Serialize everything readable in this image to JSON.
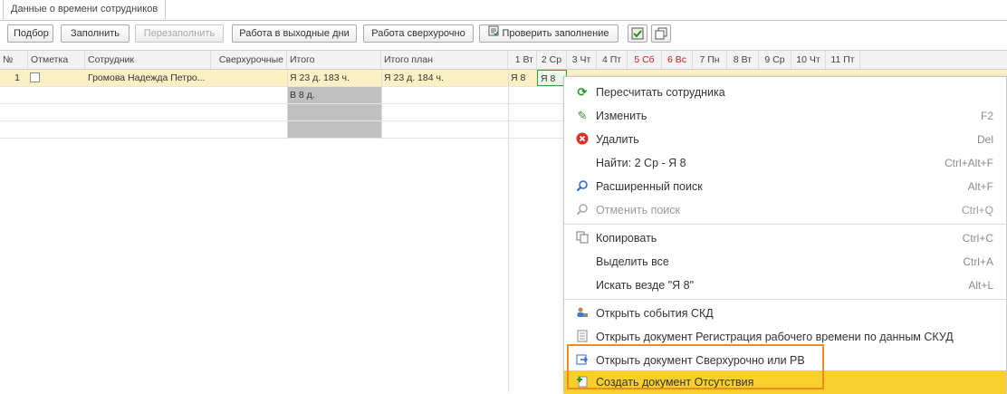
{
  "tab": {
    "label": "Данные о времени сотрудников"
  },
  "toolbar": {
    "podbor": "Подбор",
    "zapolnit": "Заполнить",
    "perezapolnit": "Перезаполнить",
    "rabota_vyh": "Работа в выходные дни",
    "rabota_sverh": "Работа сверхурочно",
    "proverit": "Проверить заполнение"
  },
  "table": {
    "headers": {
      "num": "№",
      "otmetka": "Отметка",
      "sotrudnik": "Сотрудник",
      "sverh": "Сверхурочные",
      "itogo": "Итого",
      "itogo_plan": "Итого план",
      "d1": "1 Вт",
      "d2": "2 Ср",
      "d3": "3 Чт",
      "d4": "4 Пт",
      "d5": "5 Сб",
      "d6": "6 Вс",
      "d7": "7 Пн",
      "d8": "8 Вт",
      "d9": "9 Ср",
      "d10": "10 Чт",
      "d11": "11 Пт"
    },
    "row1": {
      "num": "1",
      "sotrudnik": "Громова Надежда Петро...",
      "itogo": "Я 23 д. 183 ч.",
      "itogo_plan": "Я 23 д. 184 ч.",
      "d1": "Я 8",
      "d2": "Я 8"
    },
    "row2": {
      "itogo": "В 8 д."
    }
  },
  "context_menu": {
    "items": [
      {
        "label": "Пересчитать сотрудника",
        "key": ""
      },
      {
        "label": "Изменить",
        "key": "F2"
      },
      {
        "label": "Удалить",
        "key": "Del"
      },
      {
        "label": "Найти: 2 Ср - Я 8",
        "key": "Ctrl+Alt+F"
      },
      {
        "label": "Расширенный поиск",
        "key": "Alt+F"
      },
      {
        "label": "Отменить поиск",
        "key": "Ctrl+Q"
      },
      {
        "label": "Копировать",
        "key": "Ctrl+C"
      },
      {
        "label": "Выделить все",
        "key": "Ctrl+A"
      },
      {
        "label": "Искать везде \"Я 8\"",
        "key": "Alt+L"
      },
      {
        "label": "Открыть события СКД",
        "key": ""
      },
      {
        "label": "Открыть документ Регистрация рабочего времени по данным СКУД",
        "key": ""
      },
      {
        "label": "Открыть документ Сверхурочно или РВ",
        "key": ""
      },
      {
        "label": "Создать документ Отсутствия",
        "key": ""
      }
    ]
  },
  "colors": {
    "highlight": "#f8cf2b",
    "row_selected": "#fbf0c4",
    "outline": "#f08c1e",
    "weekend": "#d02020"
  }
}
